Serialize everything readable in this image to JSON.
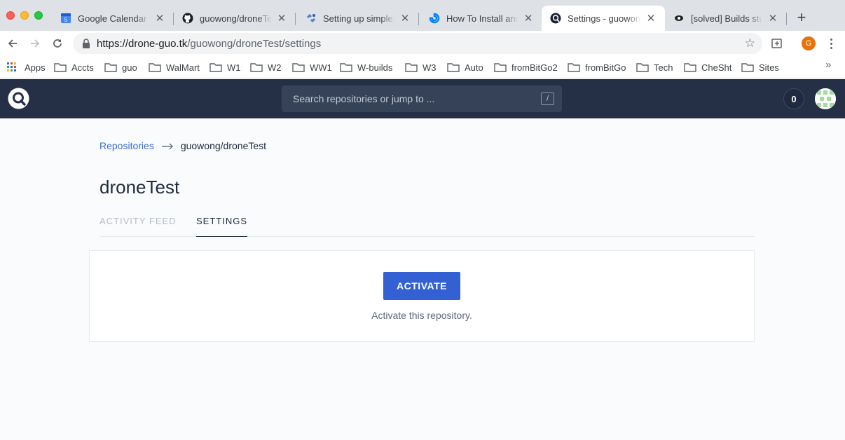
{
  "browser": {
    "tabs": [
      {
        "title": "Google Calendar - W",
        "favicon": "calendar-icon",
        "favicon_text": "5"
      },
      {
        "title": "guowong/droneTest",
        "favicon": "github-icon"
      },
      {
        "title": "Setting up simple, s",
        "favicon": "puzzle-icon"
      },
      {
        "title": "How To Install and U",
        "favicon": "digitalocean-icon"
      },
      {
        "title": "Settings - guowong",
        "favicon": "drone-icon",
        "active": true
      },
      {
        "title": "[solved] Builds stuc",
        "favicon": "discourse-icon"
      }
    ],
    "url": {
      "origin": "https://drone-guo.tk",
      "path": "/guowong/droneTest/settings"
    },
    "profile_initial": "G",
    "bookmarks": [
      "Apps",
      "Accts",
      "guo",
      "WalMart",
      "W1",
      "W2",
      "WW1",
      "W-builds",
      "W3",
      "Auto",
      "fromBitGo2",
      "fromBitGo",
      "Tech",
      "CheSht",
      "Sites"
    ],
    "bookmarks_more": "»"
  },
  "drone": {
    "search_placeholder": "Search repositories or jump to ...",
    "search_shortcut": "/",
    "counter": "0",
    "colors": {
      "header_bg": "#253047",
      "accent": "#3361d3",
      "link": "#3f6fd1"
    }
  },
  "main": {
    "breadcrumb": {
      "root": "Repositories",
      "current": "guowong/droneTest"
    },
    "title": "droneTest",
    "tabs": [
      {
        "label": "ACTIVITY FEED",
        "active": false
      },
      {
        "label": "SETTINGS",
        "active": true
      }
    ],
    "activate_label": "ACTIVATE",
    "activate_hint": "Activate this repository."
  }
}
